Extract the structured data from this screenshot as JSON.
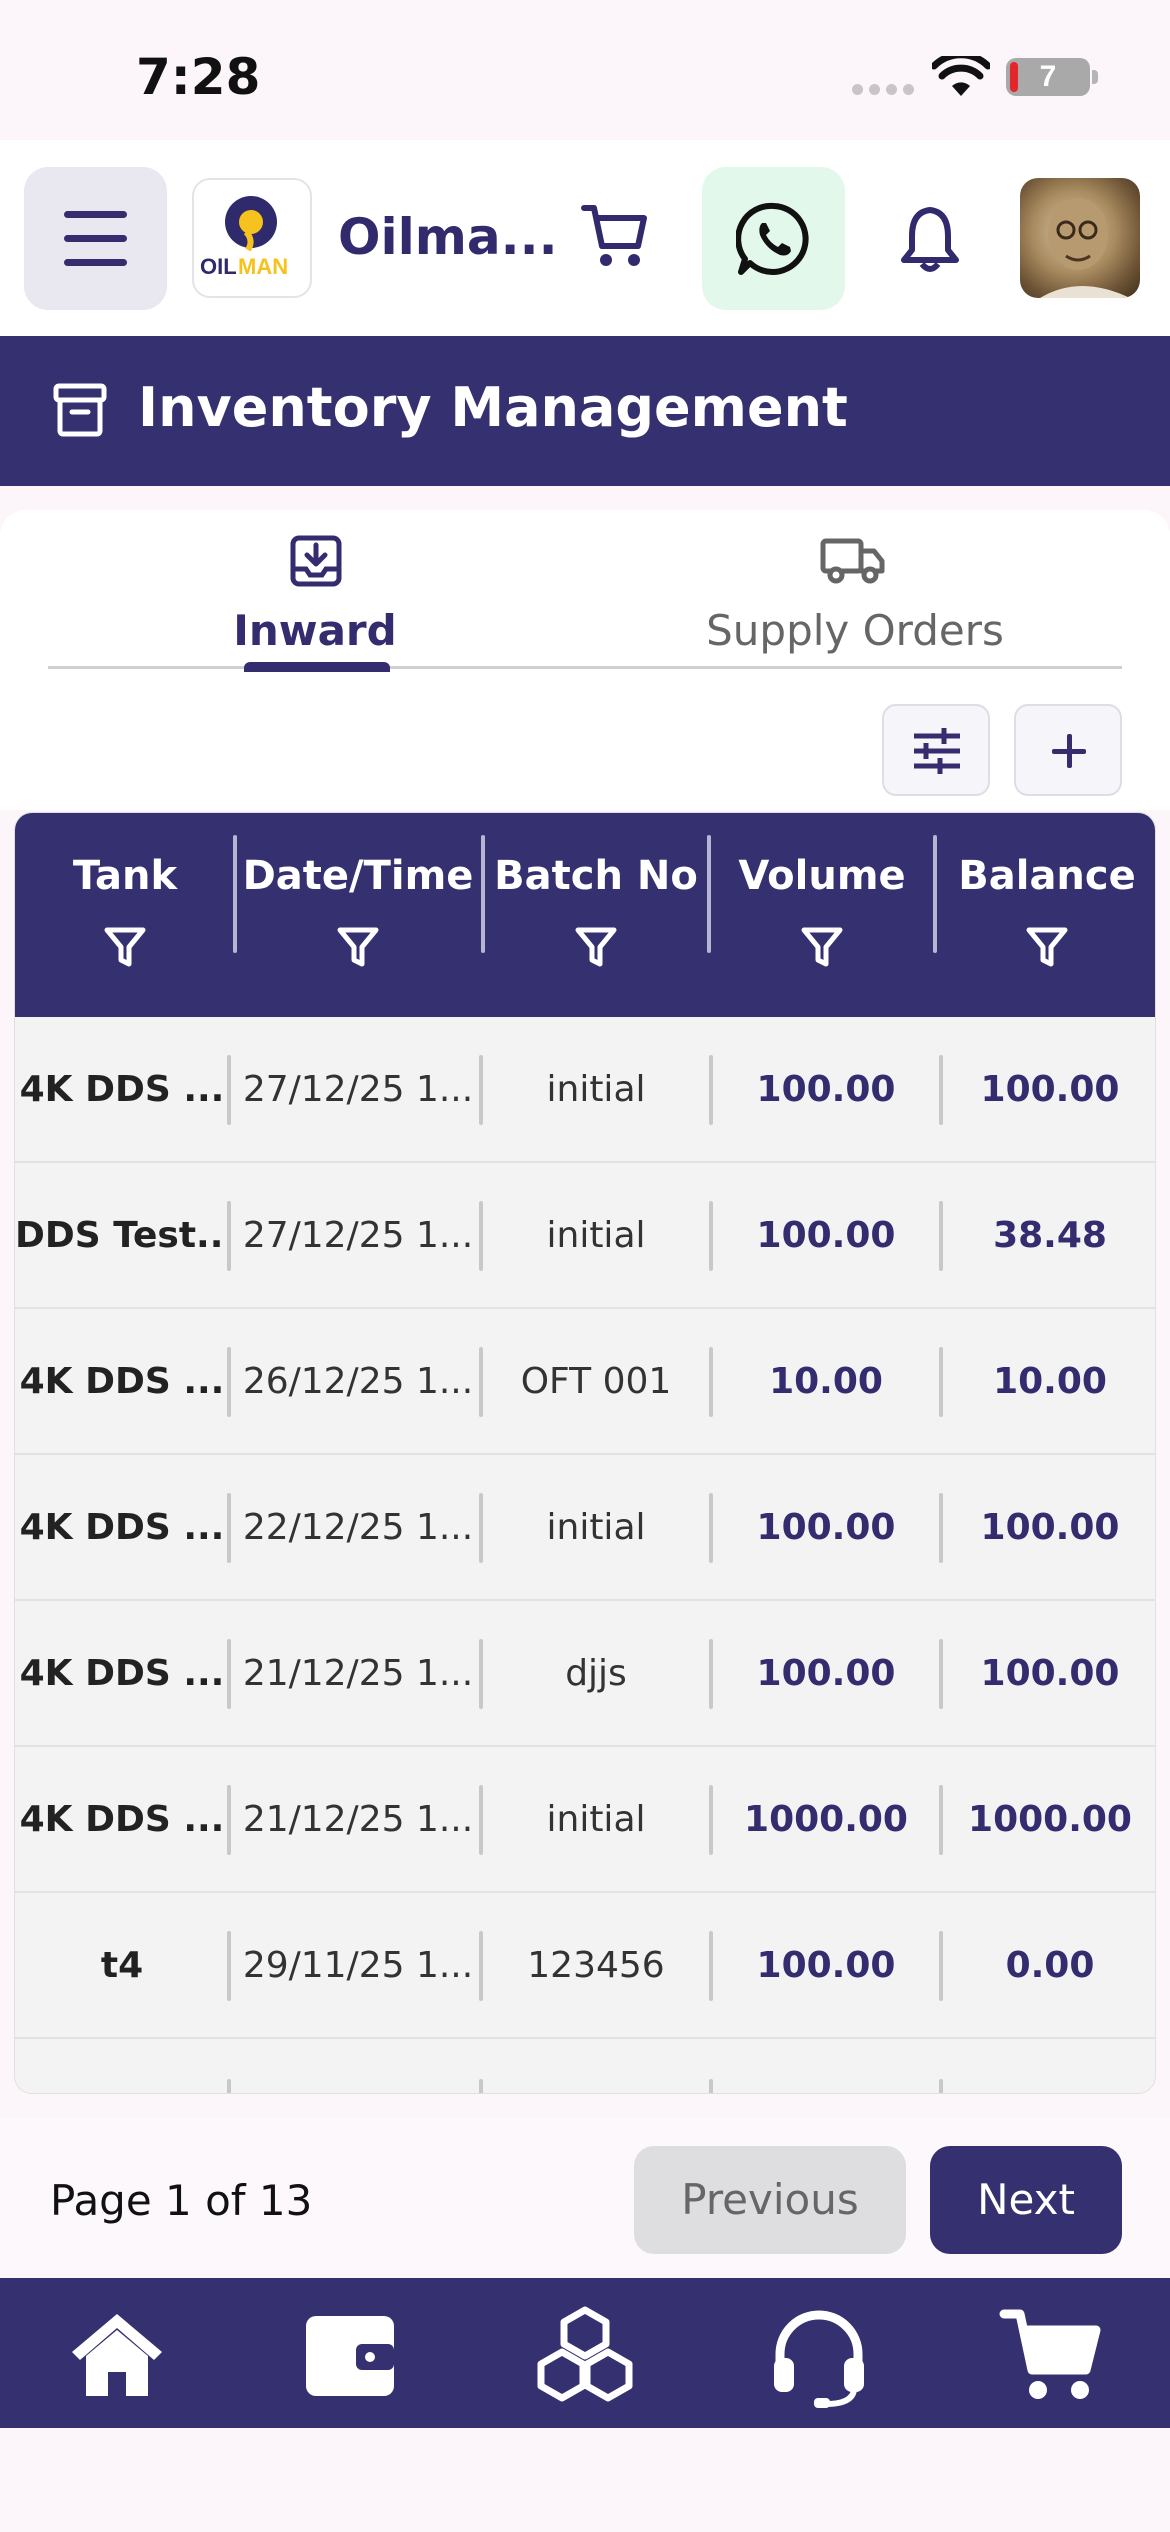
{
  "status_bar": {
    "time": "7:28",
    "battery": "7"
  },
  "header": {
    "brand": "Oilma...",
    "logo_text": "OILMAN",
    "icons": [
      "menu-icon",
      "cart-icon",
      "whatsapp-icon",
      "bell-icon"
    ]
  },
  "page": {
    "title": "Inventory Management"
  },
  "tabs": [
    {
      "label": "Inward",
      "icon": "inbox-download-icon",
      "active": true
    },
    {
      "label": "Supply Orders",
      "icon": "truck-icon",
      "active": false
    }
  ],
  "table": {
    "columns": [
      "Tank",
      "Date/Time",
      "Batch No",
      "Volume",
      "Balance"
    ],
    "rows": [
      {
        "tank": "4K DDS ...",
        "date": "27/12/25 1...",
        "batch": "initial",
        "volume": "100.00",
        "balance": "100.00"
      },
      {
        "tank": "DDS Test...",
        "date": "27/12/25 1...",
        "batch": "initial",
        "volume": "100.00",
        "balance": "38.48"
      },
      {
        "tank": "4K DDS ...",
        "date": "26/12/25 1...",
        "batch": "OFT 001",
        "volume": "10.00",
        "balance": "10.00"
      },
      {
        "tank": "4K DDS ...",
        "date": "22/12/25 1...",
        "batch": "initial",
        "volume": "100.00",
        "balance": "100.00"
      },
      {
        "tank": "4K DDS ...",
        "date": "21/12/25 1...",
        "batch": "djjs",
        "volume": "100.00",
        "balance": "100.00"
      },
      {
        "tank": "4K DDS ...",
        "date": "21/12/25 1...",
        "batch": "initial",
        "volume": "1000.00",
        "balance": "1000.00"
      },
      {
        "tank": "t4",
        "date": "29/11/25 1...",
        "batch": "123456",
        "volume": "100.00",
        "balance": "0.00"
      }
    ]
  },
  "pagination": {
    "info": "Page 1 of 13",
    "previous": "Previous",
    "next": "Next"
  },
  "bottom_nav": [
    "home-icon",
    "wallet-icon",
    "cubes-icon",
    "headset-icon",
    "cart-icon"
  ],
  "colors": {
    "primary": "#35306f",
    "background": "#fcf6fb",
    "whatsapp_bg": "#e2f8ea"
  }
}
